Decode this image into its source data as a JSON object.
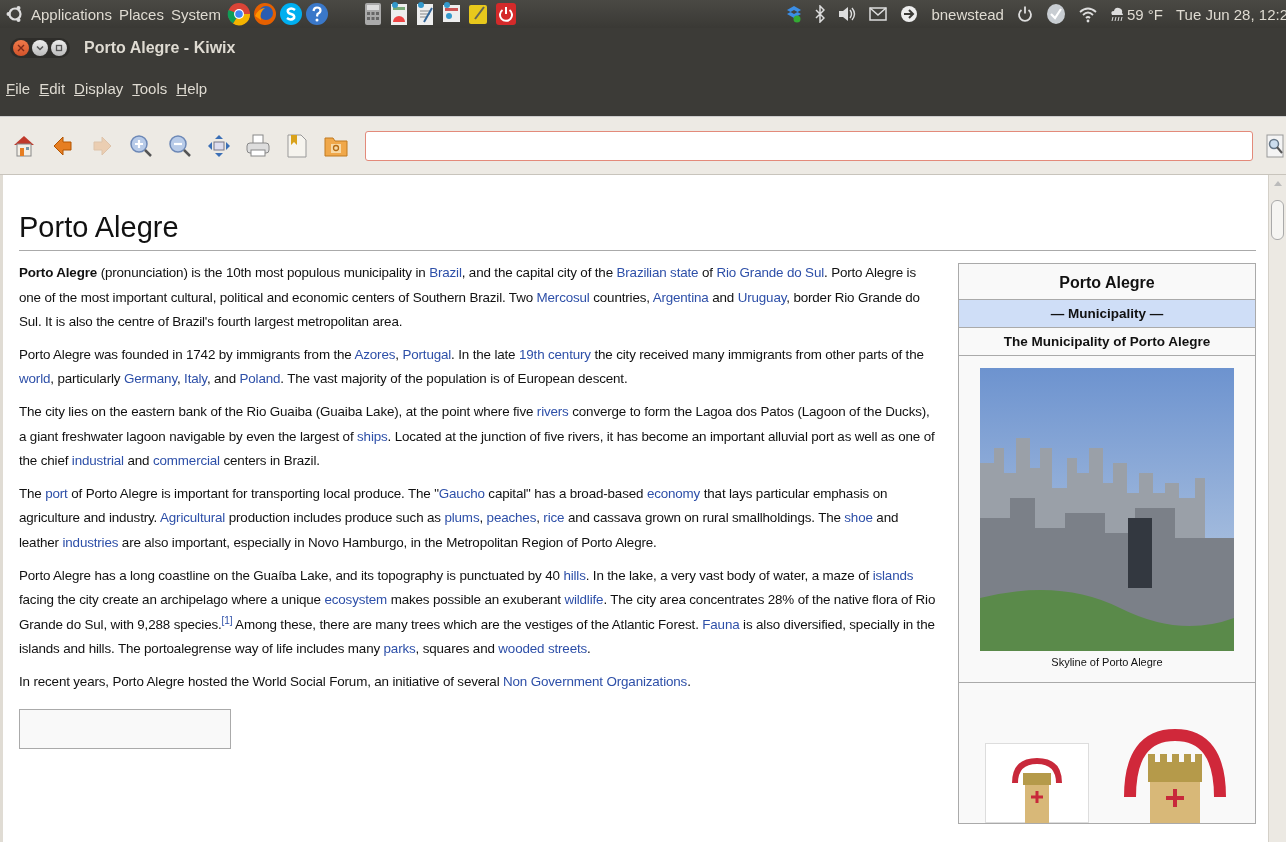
{
  "panel": {
    "menus": [
      "Applications",
      "Places",
      "System"
    ],
    "user": "bnewstead",
    "weather": "59 °F",
    "clock": "Tue Jun 28, 12:2"
  },
  "window": {
    "title": "Porto Alegre - Kiwix"
  },
  "menubar": [
    "File",
    "Edit",
    "Display",
    "Tools",
    "Help"
  ],
  "toolbar": {
    "buttons": [
      {
        "kind": "home",
        "disabled": false
      },
      {
        "kind": "back",
        "disabled": false
      },
      {
        "kind": "forward",
        "disabled": true
      },
      {
        "kind": "zoom-in",
        "disabled": false
      },
      {
        "kind": "zoom-out",
        "disabled": false
      },
      {
        "kind": "fit",
        "disabled": false
      },
      {
        "kind": "print",
        "disabled": false
      },
      {
        "kind": "bookmark",
        "disabled": false
      },
      {
        "kind": "library",
        "disabled": false
      }
    ],
    "address": {
      "focused": true
    }
  },
  "article": {
    "title": "Porto Alegre",
    "paragraphs": [
      [
        {
          "kind": "bold",
          "text": "Porto Alegre"
        },
        {
          "kind": "plain",
          "text": " (pronunciation) is the 10th most populous municipality in "
        },
        {
          "kind": "link",
          "text": "Brazil"
        },
        {
          "kind": "plain",
          "text": ", and the capital city of the "
        },
        {
          "kind": "link",
          "text": "Brazilian state"
        },
        {
          "kind": "plain",
          "text": " of "
        },
        {
          "kind": "link",
          "text": "Rio Grande do Sul"
        },
        {
          "kind": "plain",
          "text": ". Porto Alegre is one of the most important cultural, political and economic centers of Southern Brazil. Two "
        },
        {
          "kind": "link",
          "text": "Mercosul"
        },
        {
          "kind": "plain",
          "text": " countries, "
        },
        {
          "kind": "link",
          "text": "Argentina"
        },
        {
          "kind": "plain",
          "text": " and "
        },
        {
          "kind": "link",
          "text": "Uruguay"
        },
        {
          "kind": "plain",
          "text": ", border Rio Grande do Sul. It is also the centre of Brazil's fourth largest metropolitan area."
        }
      ],
      [
        {
          "kind": "plain",
          "text": "Porto Alegre was founded in 1742 by immigrants from the "
        },
        {
          "kind": "link",
          "text": "Azores"
        },
        {
          "kind": "plain",
          "text": ", "
        },
        {
          "kind": "link",
          "text": "Portugal"
        },
        {
          "kind": "plain",
          "text": ". In the late "
        },
        {
          "kind": "link",
          "text": "19th century"
        },
        {
          "kind": "plain",
          "text": " the city received many immigrants from other parts of the "
        },
        {
          "kind": "link",
          "text": "world"
        },
        {
          "kind": "plain",
          "text": ", particularly "
        },
        {
          "kind": "link",
          "text": "Germany"
        },
        {
          "kind": "plain",
          "text": ", "
        },
        {
          "kind": "link",
          "text": "Italy"
        },
        {
          "kind": "plain",
          "text": ", and "
        },
        {
          "kind": "link",
          "text": "Poland"
        },
        {
          "kind": "plain",
          "text": ". The vast majority of the population is of European descent."
        }
      ],
      [
        {
          "kind": "plain",
          "text": "The city lies on the eastern bank of the Rio Guaiba (Guaiba Lake), at the point where five "
        },
        {
          "kind": "link",
          "text": "rivers"
        },
        {
          "kind": "plain",
          "text": " converge to form the Lagoa dos Patos (Lagoon of the Ducks), a giant freshwater lagoon navigable by even the largest of "
        },
        {
          "kind": "link",
          "text": "ships"
        },
        {
          "kind": "plain",
          "text": ". Located at the junction of five rivers, it has become an important alluvial port as well as one of the chief "
        },
        {
          "kind": "link",
          "text": "industrial"
        },
        {
          "kind": "plain",
          "text": " and "
        },
        {
          "kind": "link",
          "text": "commercial"
        },
        {
          "kind": "plain",
          "text": " centers in Brazil."
        }
      ],
      [
        {
          "kind": "plain",
          "text": "The "
        },
        {
          "kind": "link",
          "text": "port"
        },
        {
          "kind": "plain",
          "text": " of Porto Alegre is important for transporting local produce. The \""
        },
        {
          "kind": "link",
          "text": "Gaucho"
        },
        {
          "kind": "plain",
          "text": " capital\" has a broad-based "
        },
        {
          "kind": "link",
          "text": "economy"
        },
        {
          "kind": "plain",
          "text": " that lays particular emphasis on agriculture and industry. "
        },
        {
          "kind": "link",
          "text": "Agricultural"
        },
        {
          "kind": "plain",
          "text": " production includes produce such as "
        },
        {
          "kind": "link",
          "text": "plums"
        },
        {
          "kind": "plain",
          "text": ", "
        },
        {
          "kind": "link",
          "text": "peaches"
        },
        {
          "kind": "plain",
          "text": ", "
        },
        {
          "kind": "link",
          "text": "rice"
        },
        {
          "kind": "plain",
          "text": " and cassava grown on rural smallholdings. The "
        },
        {
          "kind": "link",
          "text": "shoe"
        },
        {
          "kind": "plain",
          "text": " and leather "
        },
        {
          "kind": "link",
          "text": "industries"
        },
        {
          "kind": "plain",
          "text": " are also important, especially in Novo Hamburgo, in the Metropolitan Region of Porto Alegre."
        }
      ],
      [
        {
          "kind": "plain",
          "text": "Porto Alegre has a long coastline on the Guaíba Lake, and its topography is punctuated by 40 "
        },
        {
          "kind": "link",
          "text": "hills"
        },
        {
          "kind": "plain",
          "text": ". In the lake, a very vast body of water, a maze of "
        },
        {
          "kind": "link",
          "text": "islands"
        },
        {
          "kind": "plain",
          "text": " facing the city create an archipelago where a unique "
        },
        {
          "kind": "link",
          "text": "ecosystem"
        },
        {
          "kind": "plain",
          "text": " makes possible an exuberant "
        },
        {
          "kind": "link",
          "text": "wildlife"
        },
        {
          "kind": "plain",
          "text": ". The city area concentrates 28% of the native flora of Rio Grande do Sul, with 9,288 species."
        },
        {
          "kind": "ref",
          "text": "[1]"
        },
        {
          "kind": "plain",
          "text": " Among these, there are many trees which are the vestiges of the Atlantic Forest. "
        },
        {
          "kind": "link",
          "text": "Fauna"
        },
        {
          "kind": "plain",
          "text": " is also diversified, specially in the islands and hills. The portoalegrense way of life includes many "
        },
        {
          "kind": "link",
          "text": "parks"
        },
        {
          "kind": "plain",
          "text": ", squares and "
        },
        {
          "kind": "link",
          "text": "wooded streets"
        },
        {
          "kind": "plain",
          "text": "."
        }
      ],
      [
        {
          "kind": "plain",
          "text": "In recent years, Porto Alegre hosted the World Social Forum, an initiative of several "
        },
        {
          "kind": "link",
          "text": "Non Government Organizations"
        },
        {
          "kind": "plain",
          "text": "."
        }
      ]
    ]
  },
  "infobox": {
    "title": "Porto Alegre",
    "subtitle": "— Municipality —",
    "name": "The Municipality of Porto Alegre",
    "image_caption": "Skyline of Porto Alegre"
  }
}
